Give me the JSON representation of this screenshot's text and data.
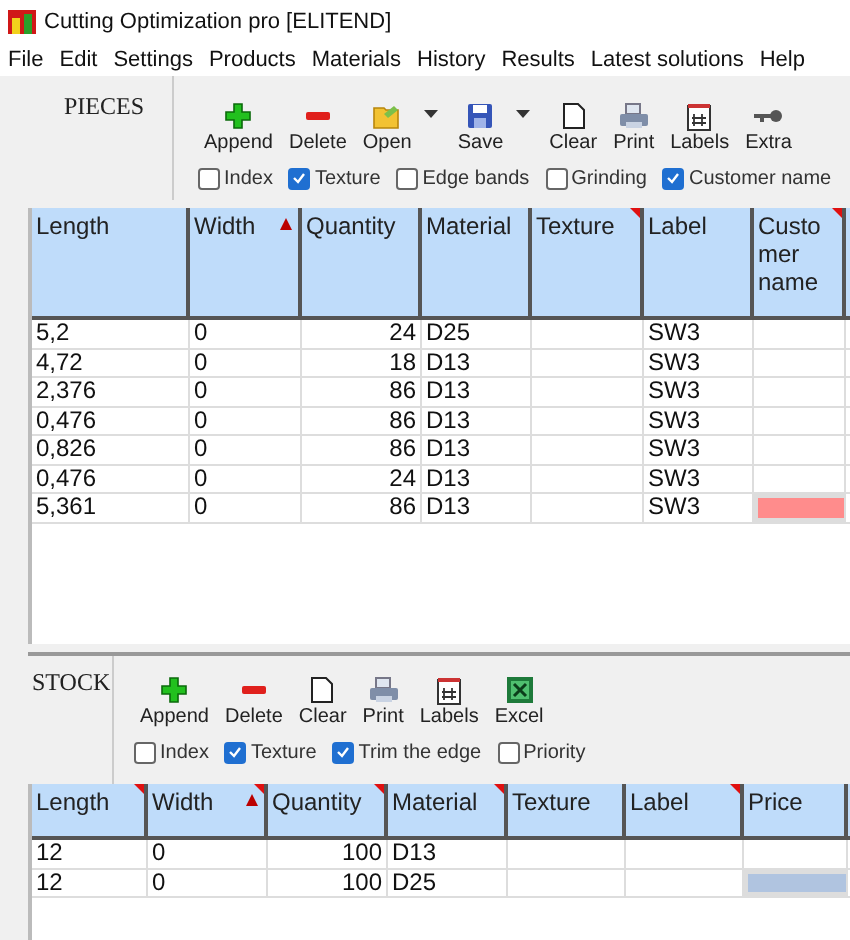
{
  "window": {
    "title": "Cutting Optimization pro [ELITEND]"
  },
  "menu": [
    "File",
    "Edit",
    "Settings",
    "Products",
    "Materials",
    "History",
    "Results",
    "Latest solutions",
    "Help"
  ],
  "pieces": {
    "title": "PIECES",
    "toolbar": [
      {
        "kind": "append",
        "label": "Append",
        "dropdown": false
      },
      {
        "kind": "delete",
        "label": "Delete",
        "dropdown": false
      },
      {
        "kind": "open",
        "label": "Open",
        "dropdown": true
      },
      {
        "kind": "save",
        "label": "Save",
        "dropdown": true
      },
      {
        "kind": "clear",
        "label": "Clear",
        "dropdown": false
      },
      {
        "kind": "print",
        "label": "Print",
        "dropdown": false
      },
      {
        "kind": "labels",
        "label": "Labels",
        "dropdown": false
      },
      {
        "kind": "extra",
        "label": "Extra",
        "dropdown": false
      }
    ],
    "options": [
      {
        "label": "Index",
        "checked": false
      },
      {
        "label": "Texture",
        "checked": true
      },
      {
        "label": "Edge bands",
        "checked": false
      },
      {
        "label": "Grinding",
        "checked": false
      },
      {
        "label": "Customer name",
        "checked": true
      }
    ],
    "columns": [
      {
        "label": "Length",
        "sorted": false,
        "marked": false
      },
      {
        "label": "Width",
        "sorted": true,
        "marked": false
      },
      {
        "label": "Quantity",
        "sorted": false,
        "marked": false
      },
      {
        "label": "Material",
        "sorted": false,
        "marked": false
      },
      {
        "label": "Texture",
        "sorted": false,
        "marked": true
      },
      {
        "label": "Label",
        "sorted": false,
        "marked": false
      },
      {
        "label": "Customer name",
        "sorted": false,
        "marked": true
      }
    ],
    "rows": [
      {
        "cells": [
          "5,2",
          "0",
          "24",
          "D25",
          "",
          "SW3",
          ""
        ],
        "flagged": false
      },
      {
        "cells": [
          "4,72",
          "0",
          "18",
          "D13",
          "",
          "SW3",
          ""
        ],
        "flagged": false
      },
      {
        "cells": [
          "2,376",
          "0",
          "86",
          "D13",
          "",
          "SW3",
          ""
        ],
        "flagged": false
      },
      {
        "cells": [
          "0,476",
          "0",
          "86",
          "D13",
          "",
          "SW3",
          ""
        ],
        "flagged": false
      },
      {
        "cells": [
          "0,826",
          "0",
          "86",
          "D13",
          "",
          "SW3",
          ""
        ],
        "flagged": false
      },
      {
        "cells": [
          "0,476",
          "0",
          "24",
          "D13",
          "",
          "SW3",
          ""
        ],
        "flagged": false
      },
      {
        "cells": [
          "5,361",
          "0",
          "86",
          "D13",
          "",
          "SW3",
          ""
        ],
        "flagged": true
      }
    ]
  },
  "stock": {
    "title": "STOCK",
    "toolbar": [
      {
        "kind": "append",
        "label": "Append",
        "dropdown": false
      },
      {
        "kind": "delete",
        "label": "Delete",
        "dropdown": false
      },
      {
        "kind": "clear",
        "label": "Clear",
        "dropdown": false
      },
      {
        "kind": "print",
        "label": "Print",
        "dropdown": false
      },
      {
        "kind": "labels",
        "label": "Labels",
        "dropdown": false
      },
      {
        "kind": "excel",
        "label": "Excel",
        "dropdown": false
      }
    ],
    "options": [
      {
        "label": "Index",
        "checked": false
      },
      {
        "label": "Texture",
        "checked": true
      },
      {
        "label": "Trim the edge",
        "checked": true
      },
      {
        "label": "Priority",
        "checked": false
      }
    ],
    "columns": [
      {
        "label": "Length",
        "sorted": false,
        "marked": true
      },
      {
        "label": "Width",
        "sorted": true,
        "marked": true
      },
      {
        "label": "Quantity",
        "sorted": false,
        "marked": true
      },
      {
        "label": "Material",
        "sorted": false,
        "marked": true
      },
      {
        "label": "Texture",
        "sorted": false,
        "marked": false
      },
      {
        "label": "Label",
        "sorted": false,
        "marked": true
      },
      {
        "label": "Price",
        "sorted": false,
        "marked": false
      }
    ],
    "rows": [
      {
        "cells": [
          "12",
          "0",
          "100",
          "D13",
          "",
          "",
          ""
        ],
        "selected": false
      },
      {
        "cells": [
          "12",
          "0",
          "100",
          "D25",
          "",
          "",
          ""
        ],
        "selected": true
      }
    ]
  }
}
